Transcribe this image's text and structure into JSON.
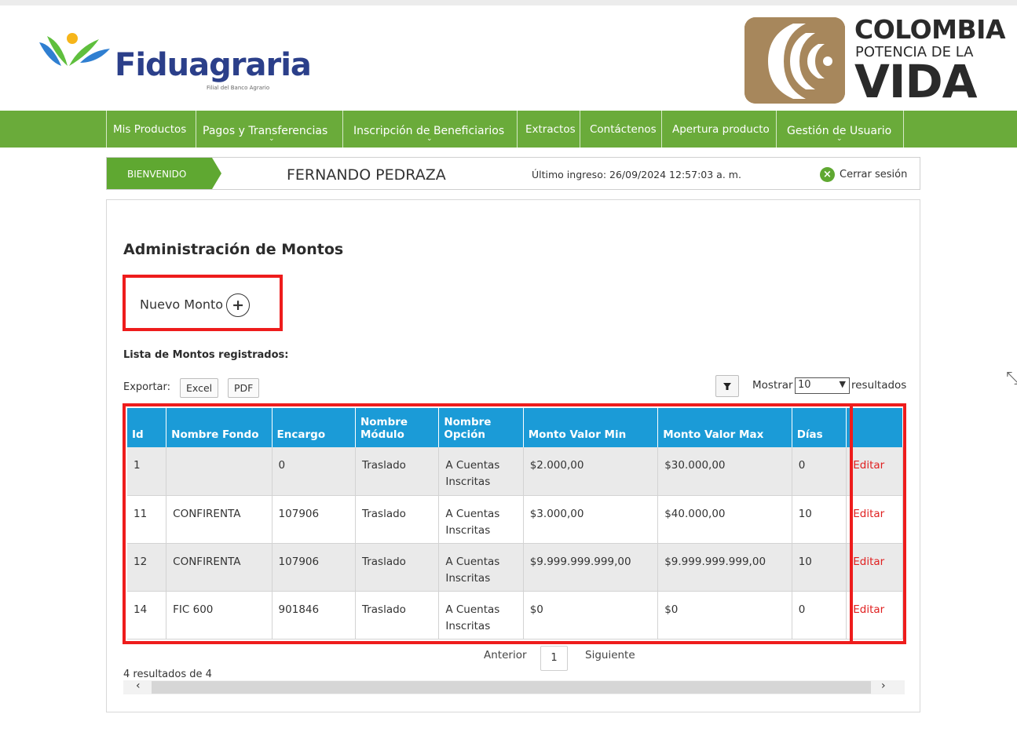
{
  "header": {
    "brand": "Fiduagraria",
    "brand_sub": "Filial del Banco Agrario",
    "gov_line1": "COLOMBIA",
    "gov_line2": "POTENCIA DE LA",
    "gov_line3": "VIDA"
  },
  "nav": [
    {
      "label": "Mis Productos",
      "dropdown": false
    },
    {
      "label": "Pagos y Transferencias",
      "dropdown": true
    },
    {
      "label": "Inscripción de Beneficiarios",
      "dropdown": true
    },
    {
      "label": "Extractos",
      "dropdown": false
    },
    {
      "label": "Contáctenos",
      "dropdown": false
    },
    {
      "label": "Apertura producto",
      "dropdown": false
    },
    {
      "label": "Gestión de Usuario",
      "dropdown": true
    }
  ],
  "welcome": {
    "tag": "BIENVENIDO",
    "user": "FERNANDO PEDRAZA",
    "last_login": "Último ingreso: 26/09/2024 12:57:03 a. m.",
    "logout": "Cerrar sesión"
  },
  "page": {
    "title": "Administración de Montos",
    "new_button": "Nuevo Monto",
    "list_title": "Lista de Montos registrados:",
    "export_label": "Exportar:",
    "excel": "Excel",
    "pdf": "PDF",
    "show_label": "Mostrar",
    "show_value": "10",
    "results_label": "resultados"
  },
  "table": {
    "headers": [
      "Id",
      "Nombre Fondo",
      "Encargo",
      "Nombre Módulo",
      "Nombre Opción",
      "Monto Valor Min",
      "Monto Valor Max",
      "Días",
      ""
    ],
    "rows": [
      [
        "1",
        "",
        "0",
        "Traslado",
        "A Cuentas Inscritas",
        "$2.000,00",
        "$30.000,00",
        "0",
        "Editar"
      ],
      [
        "11",
        "CONFIRENTA",
        "107906",
        "Traslado",
        "A Cuentas Inscritas",
        "$3.000,00",
        "$40.000,00",
        "10",
        "Editar"
      ],
      [
        "12",
        "CONFIRENTA",
        "107906",
        "Traslado",
        "A Cuentas Inscritas",
        "$9.999.999.999,00",
        "$9.999.999.999,00",
        "10",
        "Editar"
      ],
      [
        "14",
        "FIC 600",
        "901846",
        "Traslado",
        "A Cuentas Inscritas",
        "$0",
        "$0",
        "0",
        "Editar"
      ]
    ]
  },
  "pagination": {
    "prev": "Anterior",
    "page": "1",
    "next": "Siguiente",
    "count": "4 resultados de 4"
  },
  "colors": {
    "nav_green": "#6aab3a",
    "table_header_blue": "#1b9bd7",
    "highlight_red": "#ee1c1c",
    "edit_link_red": "#e02020"
  }
}
